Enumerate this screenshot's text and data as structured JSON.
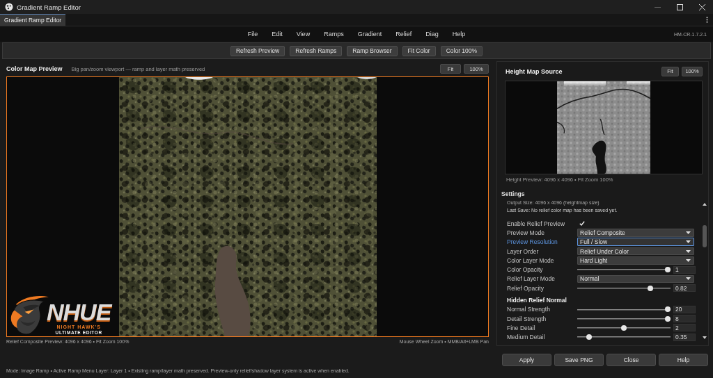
{
  "window": {
    "title": "Gradient Ramp Editor"
  },
  "tabs": [
    {
      "label": "Gradient Ramp Editor",
      "selected": true
    }
  ],
  "menu": {
    "items": [
      "File",
      "Edit",
      "View",
      "Ramps",
      "Gradient",
      "Relief",
      "Diag",
      "Help"
    ],
    "version": "HM-CR-1.7.2.1"
  },
  "toolbar": {
    "buttons": [
      "Refresh Preview",
      "Refresh Ramps",
      "Ramp Browser",
      "Fit Color",
      "Color 100%"
    ]
  },
  "color_preview": {
    "title": "Color Map Preview",
    "subtitle": "Big pan/zoom viewport — ramp and layer math preserved",
    "buttons": [
      "Fit",
      "100%"
    ],
    "logo": {
      "wordmark": "NHUE",
      "tagline": "NIGHT HAWK'S",
      "subtitle": "ULTIMATE EDITOR"
    },
    "footer_left": "Relief Composite Preview: 4096 x 4096 • Fit Zoom 100%",
    "footer_right": "Mouse Wheel Zoom • MMB/Alt+LMB Pan"
  },
  "height_preview": {
    "title": "Height Map Source",
    "buttons": [
      "Fit",
      "100%"
    ],
    "caption": "Height Preview: 4096 x 4096 • Fit Zoom 100%"
  },
  "settings": {
    "title": "Settings",
    "info": [
      "Output Size: 4096 x 4096 (heightmap size)",
      "Last Save: No relief color map has been saved yet."
    ],
    "rows": [
      {
        "kind": "checkbox",
        "label": "Enable Relief Preview",
        "checked": true,
        "focused": false
      },
      {
        "kind": "select",
        "label": "Preview Mode",
        "value": "Relief Composite",
        "focused": false
      },
      {
        "kind": "select",
        "label": "Preview Resolution",
        "value": "Full / Slow",
        "focused": true
      },
      {
        "kind": "select",
        "label": "Layer Order",
        "value": "Relief Under Color",
        "focused": false
      },
      {
        "kind": "select",
        "label": "Color Layer Mode",
        "value": "Hard Light",
        "focused": false
      },
      {
        "kind": "slider",
        "label": "Color Opacity",
        "level": 1,
        "value": "1",
        "focused": false
      },
      {
        "kind": "select",
        "label": "Relief Layer Mode",
        "value": "Normal",
        "focused": false
      },
      {
        "kind": "slider",
        "label": "Relief Opacity",
        "level": 0.8,
        "value": "0.82",
        "focused": false
      },
      {
        "kind": "heading",
        "label": "Hidden Relief Normal",
        "focused": false
      },
      {
        "kind": "slider",
        "label": "Normal Strength",
        "level": 1,
        "value": "20",
        "focused": false
      },
      {
        "kind": "slider",
        "label": "Detail Strength",
        "level": 1,
        "value": "8",
        "focused": false
      },
      {
        "kind": "slider",
        "label": "Fine Detail",
        "level": 0.5,
        "value": "2",
        "focused": false
      },
      {
        "kind": "slider",
        "label": "Medium Detail",
        "level": 0.1,
        "value": "0.35",
        "focused": false
      }
    ]
  },
  "buttons": [
    "Apply",
    "Save PNG",
    "Close",
    "Help"
  ],
  "status_bar": "Mode: Image Ramp • Active Ramp Menu Layer: Layer 1 • Existing ramp/layer math preserved. Preview-only relief/shadow layer system is active when enabled."
}
